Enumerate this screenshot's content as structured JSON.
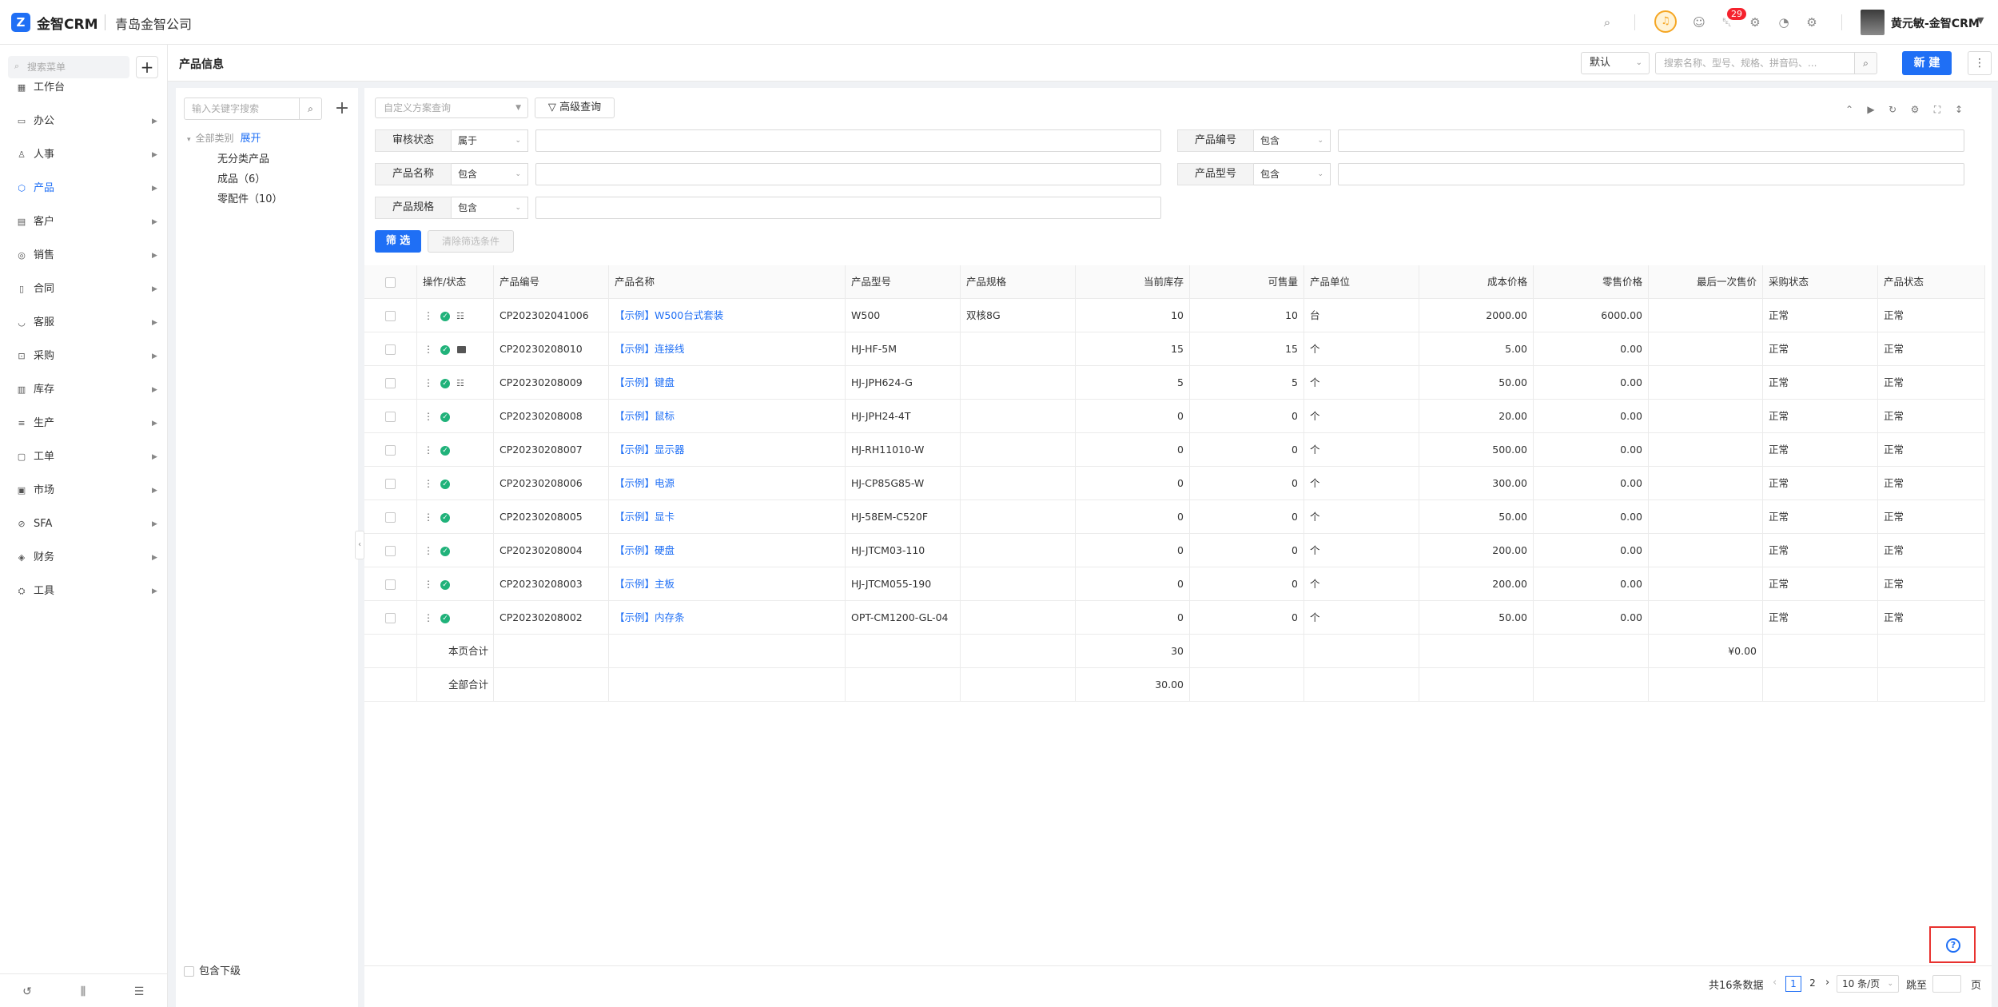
{
  "app": {
    "brand": "金智CRM",
    "company": "青岛金智公司",
    "logo_glyph": "Z",
    "accent_color": "#1f6ff5",
    "notification_count": "29",
    "user_name": "黄元敏-金智CRM"
  },
  "sidebar": {
    "search_placeholder": "搜索菜单",
    "items": [
      {
        "label": "工作台",
        "icon": "dashboard-icon",
        "has_arrow": false
      },
      {
        "label": "办公",
        "icon": "office-icon",
        "has_arrow": true
      },
      {
        "label": "人事",
        "icon": "people-icon",
        "has_arrow": true
      },
      {
        "label": "产品",
        "icon": "product-icon",
        "has_arrow": true,
        "active": true
      },
      {
        "label": "客户",
        "icon": "customer-icon",
        "has_arrow": true
      },
      {
        "label": "销售",
        "icon": "sales-icon",
        "has_arrow": true
      },
      {
        "label": "合同",
        "icon": "contract-icon",
        "has_arrow": true
      },
      {
        "label": "客服",
        "icon": "service-icon",
        "has_arrow": true
      },
      {
        "label": "采购",
        "icon": "purchase-icon",
        "has_arrow": true
      },
      {
        "label": "库存",
        "icon": "inventory-icon",
        "has_arrow": true
      },
      {
        "label": "生产",
        "icon": "production-icon",
        "has_arrow": true
      },
      {
        "label": "工单",
        "icon": "workorder-icon",
        "has_arrow": true
      },
      {
        "label": "市场",
        "icon": "market-icon",
        "has_arrow": true
      },
      {
        "label": "SFA",
        "icon": "sfa-icon",
        "has_arrow": true
      },
      {
        "label": "财务",
        "icon": "finance-icon",
        "has_arrow": true
      },
      {
        "label": "工具",
        "icon": "tools-icon",
        "has_arrow": true
      }
    ]
  },
  "header": {
    "title": "产品信息",
    "view_select": "默认",
    "search_placeholder": "搜索名称、型号、规格、拼音码、...",
    "new_label": "新 建"
  },
  "category": {
    "search_placeholder": "输入关键字搜索",
    "root_label": "全部类别",
    "expand_label": "展开",
    "children": [
      "无分类产品",
      "成品（6）",
      "零配件（10）"
    ],
    "include_sub_label": "包含下级"
  },
  "filters": {
    "scheme_placeholder": "自定义方案查询",
    "advanced_label": "高级查询",
    "rows": [
      {
        "label": "审核状态",
        "op": "属于"
      },
      {
        "label": "产品编号",
        "op": "包含"
      },
      {
        "label": "产品名称",
        "op": "包含"
      },
      {
        "label": "产品型号",
        "op": "包含"
      },
      {
        "label": "产品规格",
        "op": "包含"
      }
    ],
    "filter_btn": "筛 选",
    "clear_btn": "清除筛选条件"
  },
  "table": {
    "columns": [
      "操作/状态",
      "产品编号",
      "产品名称",
      "产品型号",
      "产品规格",
      "当前库存",
      "可售量",
      "产品单位",
      "成本价格",
      "零售价格",
      "最后一次售价",
      "采购状态",
      "产品状态"
    ],
    "rows": [
      {
        "code": "CP202302041006",
        "name": "【示例】W500台式套装",
        "model": "W500",
        "spec": "双核8G",
        "stock": "10",
        "sellable": "10",
        "unit": "台",
        "cost": "2000.00",
        "retail": "6000.00",
        "last": "",
        "purchase": "正常",
        "status": "正常",
        "extra": "tree"
      },
      {
        "code": "CP20230208010",
        "name": "【示例】连接线",
        "model": "HJ-HF-5M",
        "spec": "",
        "stock": "15",
        "sellable": "15",
        "unit": "个",
        "cost": "5.00",
        "retail": "0.00",
        "last": "",
        "purchase": "正常",
        "status": "正常",
        "extra": "img"
      },
      {
        "code": "CP20230208009",
        "name": "【示例】键盘",
        "model": "HJ-JPH624-G",
        "spec": "",
        "stock": "5",
        "sellable": "5",
        "unit": "个",
        "cost": "50.00",
        "retail": "0.00",
        "last": "",
        "purchase": "正常",
        "status": "正常",
        "extra": "tree"
      },
      {
        "code": "CP20230208008",
        "name": "【示例】鼠标",
        "model": "HJ-JPH24-4T",
        "spec": "",
        "stock": "0",
        "sellable": "0",
        "unit": "个",
        "cost": "20.00",
        "retail": "0.00",
        "last": "",
        "purchase": "正常",
        "status": "正常",
        "extra": ""
      },
      {
        "code": "CP20230208007",
        "name": "【示例】显示器",
        "model": "HJ-RH11010-W",
        "spec": "",
        "stock": "0",
        "sellable": "0",
        "unit": "个",
        "cost": "500.00",
        "retail": "0.00",
        "last": "",
        "purchase": "正常",
        "status": "正常",
        "extra": ""
      },
      {
        "code": "CP20230208006",
        "name": "【示例】电源",
        "model": "HJ-CP85G85-W",
        "spec": "",
        "stock": "0",
        "sellable": "0",
        "unit": "个",
        "cost": "300.00",
        "retail": "0.00",
        "last": "",
        "purchase": "正常",
        "status": "正常",
        "extra": ""
      },
      {
        "code": "CP20230208005",
        "name": "【示例】显卡",
        "model": "HJ-58EM-C520F",
        "spec": "",
        "stock": "0",
        "sellable": "0",
        "unit": "个",
        "cost": "50.00",
        "retail": "0.00",
        "last": "",
        "purchase": "正常",
        "status": "正常",
        "extra": ""
      },
      {
        "code": "CP20230208004",
        "name": "【示例】硬盘",
        "model": "HJ-JTCM03-110",
        "spec": "",
        "stock": "0",
        "sellable": "0",
        "unit": "个",
        "cost": "200.00",
        "retail": "0.00",
        "last": "",
        "purchase": "正常",
        "status": "正常",
        "extra": ""
      },
      {
        "code": "CP20230208003",
        "name": "【示例】主板",
        "model": "HJ-JTCM055-190",
        "spec": "",
        "stock": "0",
        "sellable": "0",
        "unit": "个",
        "cost": "200.00",
        "retail": "0.00",
        "last": "",
        "purchase": "正常",
        "status": "正常",
        "extra": ""
      },
      {
        "code": "CP20230208002",
        "name": "【示例】内存条",
        "model": "OPT-CM1200-GL-04",
        "spec": "",
        "stock": "0",
        "sellable": "0",
        "unit": "个",
        "cost": "50.00",
        "retail": "0.00",
        "last": "",
        "purchase": "正常",
        "status": "正常",
        "extra": ""
      }
    ],
    "page_total_label": "本页合计",
    "page_total_stock": "30",
    "page_total_last": "¥0.00",
    "all_total_label": "全部合计",
    "all_total_stock": "30.00"
  },
  "pagination": {
    "total": "共16条数据",
    "pages": [
      "1",
      "2"
    ],
    "current": "1",
    "page_size": "10 条/页",
    "jump_label": "跳至",
    "page_unit": "页"
  }
}
